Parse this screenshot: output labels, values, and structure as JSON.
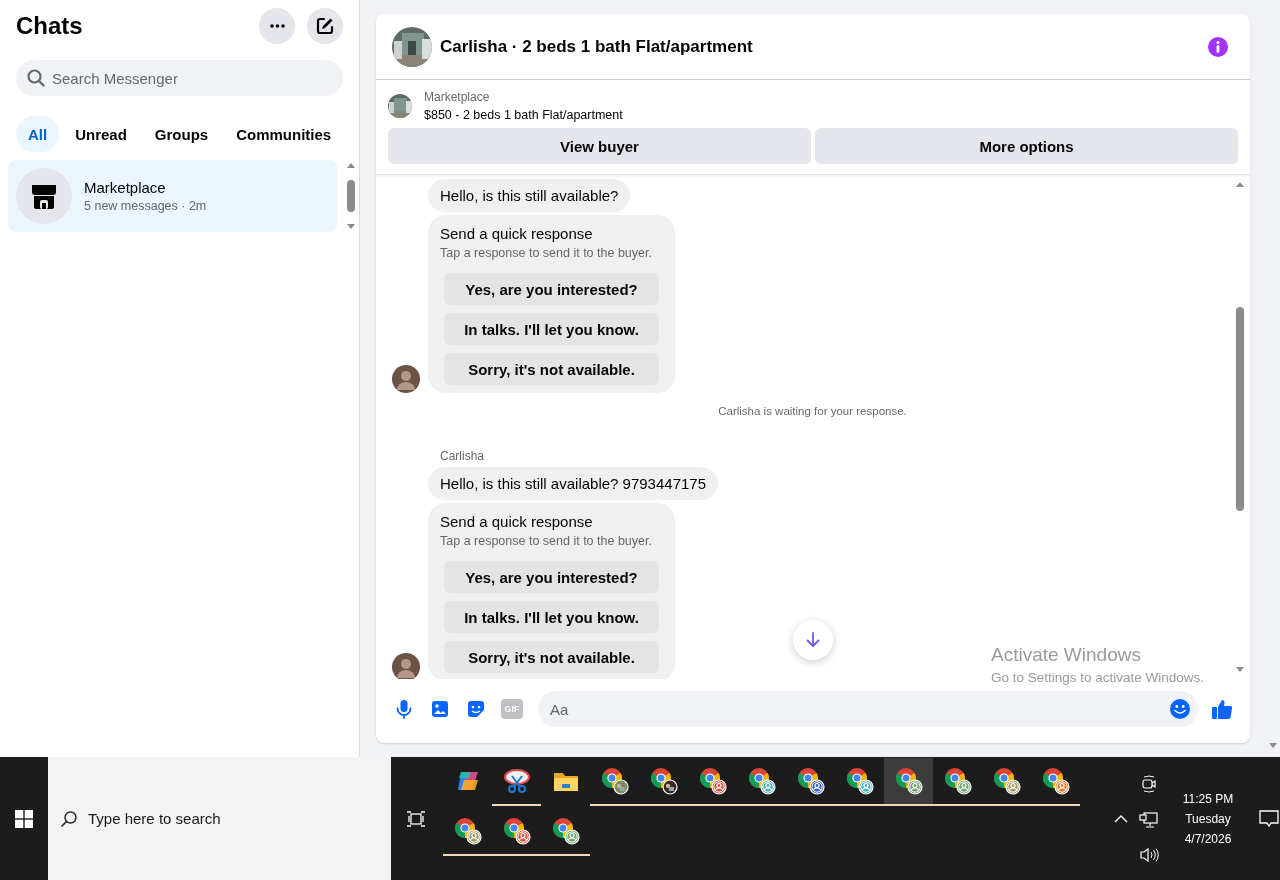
{
  "sidebar": {
    "title": "Chats",
    "search": {
      "placeholder": "Search Messenger"
    },
    "filters": [
      {
        "label": "All",
        "selected": true
      },
      {
        "label": "Unread",
        "selected": false
      },
      {
        "label": "Groups",
        "selected": false
      },
      {
        "label": "Communities",
        "selected": false
      }
    ],
    "conversations": [
      {
        "name": "Marketplace",
        "preview": "5 new messages · 2m",
        "selected": true
      }
    ]
  },
  "chat": {
    "title": "Carlisha · 2 beds 1 bath Flat/apartment",
    "listing": {
      "source": "Marketplace",
      "summary": "$850 - 2 beds 1 bath Flat/apartment"
    },
    "actions": [
      "View buyer",
      "More options"
    ],
    "messages": [
      {
        "kind": "bubble",
        "text": "Hello, is this still available?"
      },
      {
        "kind": "quick_response",
        "title": "Send a quick response",
        "hint": "Tap a response to send it to the buyer.",
        "options": [
          "Yes, are you interested?",
          "In talks. I'll let you know.",
          "Sorry, it's not available."
        ]
      },
      {
        "kind": "status",
        "text": "Carlisha is waiting for your response."
      },
      {
        "kind": "sender",
        "text": "Carlisha"
      },
      {
        "kind": "bubble",
        "text": "Hello, is this still available? 9793447175"
      },
      {
        "kind": "quick_response",
        "title": "Send a quick response",
        "hint": "Tap a response to send it to the buyer.",
        "options": [
          "Yes, are you interested?",
          "In talks. I'll let you know.",
          "Sorry, it's not available."
        ]
      }
    ],
    "composer": {
      "gif_label": "GIF",
      "placeholder": "Aa"
    }
  },
  "windows_notice": {
    "title": "Activate Windows",
    "text": "Go to Settings to activate Windows."
  },
  "taskbar": {
    "search_placeholder": "Type here to search",
    "apps": [
      {
        "kind": "copilot",
        "running": false,
        "selected": false
      },
      {
        "kind": "snip",
        "running": true,
        "selected": false
      },
      {
        "kind": "folder",
        "running": false,
        "selected": false
      },
      {
        "kind": "chrome_photo",
        "running": true,
        "selected": false,
        "color": "#7a8a5a"
      },
      {
        "kind": "chrome_photo",
        "running": true,
        "selected": false,
        "color": "#3a2a22"
      },
      {
        "kind": "chrome_profile",
        "running": true,
        "selected": false,
        "color": "#e0523b"
      },
      {
        "kind": "chrome_profile",
        "running": true,
        "selected": false,
        "color": "#4fb3bf"
      },
      {
        "kind": "chrome_profile",
        "running": true,
        "selected": false,
        "color": "#3f5fd0"
      },
      {
        "kind": "chrome_profile",
        "running": true,
        "selected": false,
        "color": "#4fb3bf"
      },
      {
        "kind": "chrome_profile",
        "running": true,
        "selected": true,
        "color": "#6aa56a"
      },
      {
        "kind": "chrome_profile",
        "running": true,
        "selected": false,
        "color": "#6aa56a"
      },
      {
        "kind": "chrome_profile",
        "running": true,
        "selected": false,
        "color": "#a39a60"
      },
      {
        "kind": "chrome_profile",
        "running": true,
        "selected": false,
        "color": "#e07a2a"
      },
      {
        "kind": "chrome_profile",
        "running": true,
        "selected": false,
        "color": "#a39a60"
      },
      {
        "kind": "chrome_profile",
        "running": true,
        "selected": false,
        "color": "#e0523b"
      },
      {
        "kind": "chrome_profile",
        "running": true,
        "selected": false,
        "color": "#6aa56a"
      }
    ],
    "clock": {
      "time": "11:25 PM",
      "day": "Tuesday",
      "date": "4/7/2026"
    }
  }
}
